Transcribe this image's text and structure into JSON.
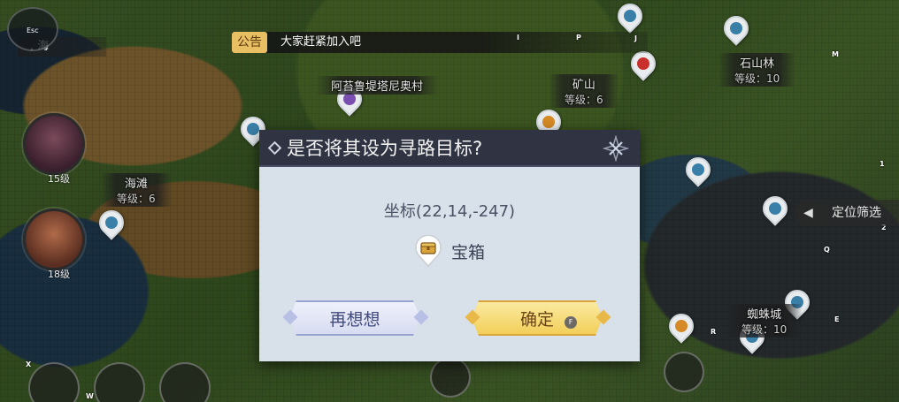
{
  "announcement": {
    "tag": "公告",
    "text": "大家赶紧加入吧"
  },
  "region_label": ", 海",
  "map_labels": [
    {
      "name": "阿苔鲁堤塔尼奥村",
      "level": ""
    },
    {
      "name": "矿山",
      "level": "等级：6"
    },
    {
      "name": "石山林",
      "level": "等级：10"
    },
    {
      "name": "海滩",
      "level": "等级：6"
    },
    {
      "name": "蜘蛛城",
      "level": "等级：10"
    }
  ],
  "avatars": [
    {
      "level": "15级"
    },
    {
      "level": "18级"
    }
  ],
  "filter": {
    "label": "定位筛选",
    "icon": "filter-arrow-icon"
  },
  "key_hints": {
    "esc": "Esc",
    "i": "I",
    "p": "P",
    "j": "J",
    "m": "M",
    "one": "1",
    "two": "2",
    "q": "Q",
    "e": "E",
    "r": "R",
    "x": "X",
    "w": "W"
  },
  "dialog": {
    "title": "是否将其设为寻路目标?",
    "coordinates": "坐标(22,14,-247)",
    "target_name": "宝箱",
    "target_icon": "treasure-chest-icon",
    "cancel_label": "再想想",
    "confirm_label": "确定",
    "confirm_key": "F"
  },
  "colors": {
    "dialog_bg": "#d8e0ea",
    "dialog_header": "#2f3342",
    "confirm": "#f1cf5a",
    "cancel": "#d8dcf1"
  }
}
